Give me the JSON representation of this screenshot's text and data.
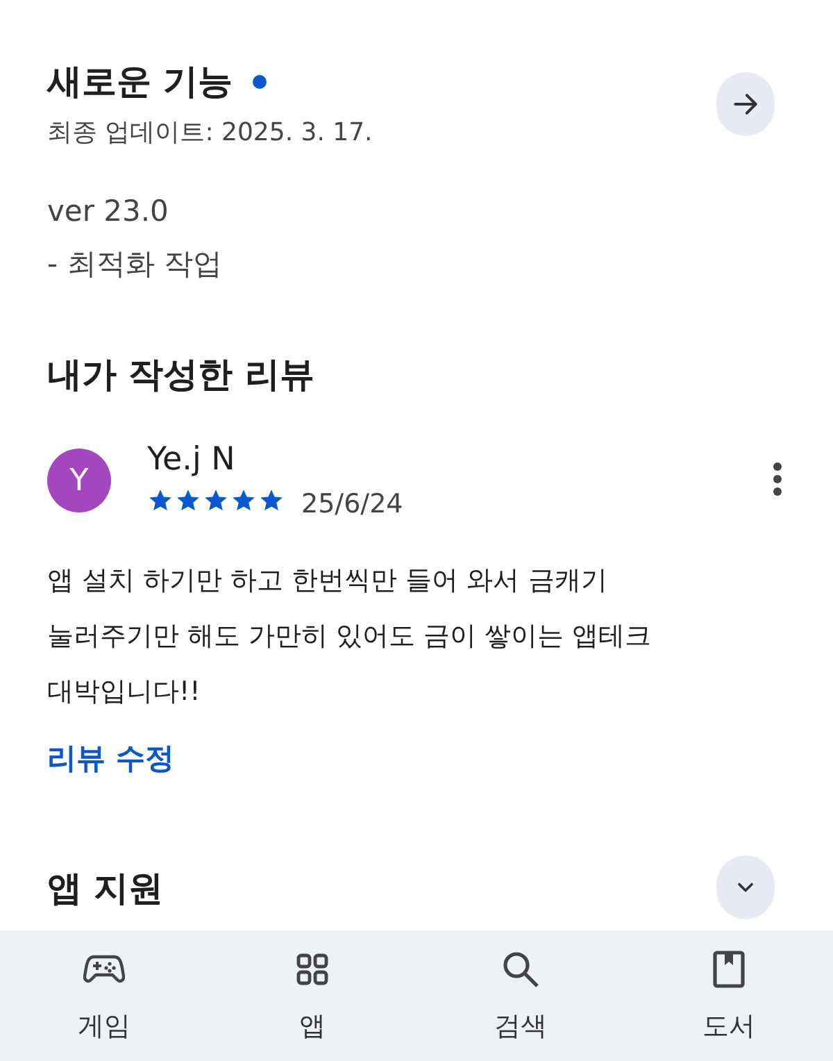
{
  "whats_new": {
    "title": "새로운 기능",
    "unread": true,
    "updated": "최종 업데이트: 2025. 3. 17.",
    "notes": [
      "ver 23.0",
      "- 최적화 작업"
    ]
  },
  "my_review": {
    "heading": "내가 작성한 리뷰",
    "avatar_letter": "Y",
    "author": "Ye.j N",
    "stars": 5,
    "date": "25/6/24",
    "text": "앱 설치 하기만 하고 한번씩만 들어 와서 금캐기 눌러주기만 해도 가만히 있어도 금이 쌓이는 앱테크 대박입니다!!",
    "edit_link": "리뷰 수정"
  },
  "app_support": {
    "heading": "앱 지원",
    "expanded": false
  },
  "bottom_nav": [
    {
      "label": "게임",
      "kind": "games"
    },
    {
      "label": "앱",
      "kind": "apps"
    },
    {
      "label": "검색",
      "kind": "search"
    },
    {
      "label": "도서",
      "kind": "books"
    }
  ]
}
